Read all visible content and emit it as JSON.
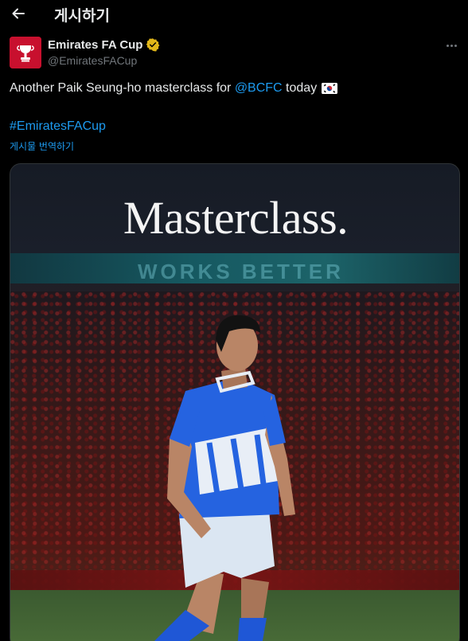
{
  "header": {
    "back_icon": "arrow-left-icon",
    "title": "게시하기"
  },
  "author": {
    "display_name": "Emirates FA Cup",
    "handle": "@EmiratesFACup",
    "verified": true,
    "verified_color": "#e2b719",
    "avatar_color": "#c8102e"
  },
  "tweet": {
    "text_before": "Another Paik Seung-ho masterclass for ",
    "mention": "@BCFC",
    "text_after": " today",
    "flag_emoji": "south-korea-flag",
    "hashtag": "#EmiratesFACup",
    "translate_label": "게시물 번역하기"
  },
  "media": {
    "headline": "Masterclass.",
    "banner_text": "WORKS BETTER"
  },
  "colors": {
    "background": "#000000",
    "text": "#e7e9ea",
    "secondary": "#71767b",
    "link": "#1d9bf0"
  }
}
